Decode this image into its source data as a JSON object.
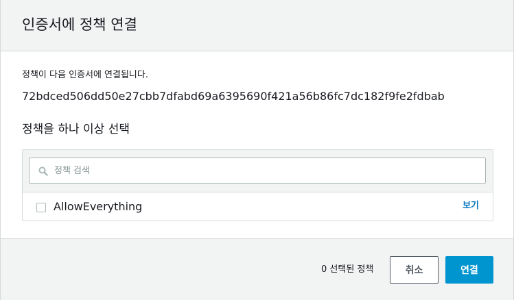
{
  "dialog": {
    "title": "인증서에 정책 연결",
    "intro_text": "정책이 다음 인증서에 연결됩니다.",
    "certificate_id": "72bdced506dd50e27cbb7dfabd69a6395690f421a56b86fc7dc182f9fe2fdbab",
    "section_title": "정책을 하나 이상 선택"
  },
  "search": {
    "placeholder": "정책 검색",
    "value": "",
    "icon": "search-icon"
  },
  "policies": [
    {
      "name": "AllowEverything",
      "checked": false,
      "view_label": "보기"
    }
  ],
  "footer": {
    "selected_count_text": "0 선택된 정책",
    "cancel_label": "취소",
    "connect_label": "연결"
  },
  "colors": {
    "primary": "#0095cf",
    "link": "#0073bb",
    "header_bg": "#f2f3f3",
    "border": "#d5dbdb"
  }
}
